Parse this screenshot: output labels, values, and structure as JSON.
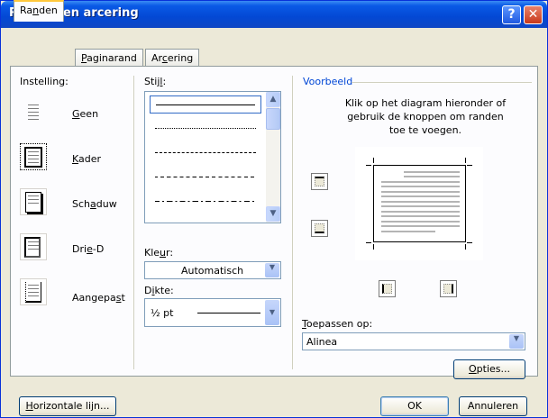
{
  "window": {
    "title": "Randen en arcering",
    "help_label": "?",
    "close_label": "✕"
  },
  "tabs": [
    {
      "label_pre": "Ra",
      "label_key": "n",
      "label_post": "den"
    },
    {
      "label_pre": "",
      "label_key": "P",
      "label_post": "aginarand"
    },
    {
      "label_pre": "Ar",
      "label_key": "c",
      "label_post": "ering"
    }
  ],
  "instelling": {
    "label": "Instelling:",
    "options": [
      {
        "pre": "",
        "key": "G",
        "post": "een"
      },
      {
        "pre": "",
        "key": "K",
        "post": "ader"
      },
      {
        "pre": "Sch",
        "key": "a",
        "post": "duw"
      },
      {
        "pre": "Dri",
        "key": "e",
        "post": "-D"
      },
      {
        "pre": "Aangepa",
        "key": "s",
        "post": "t"
      }
    ]
  },
  "stijl": {
    "label_pre": "Stij",
    "label_key": "l",
    "label_post": ":"
  },
  "kleur": {
    "label_pre": "Kle",
    "label_key": "u",
    "label_post": "r:",
    "value": "Automatisch"
  },
  "dikte": {
    "label_pre": "D",
    "label_key": "i",
    "label_post": "kte:",
    "value": "½ pt"
  },
  "voorbeeld": {
    "label": "Voorbeeld",
    "instruction_1": "Klik op het diagram hieronder of",
    "instruction_2": "gebruik de knoppen om randen",
    "instruction_3": "toe te voegen."
  },
  "toepassen": {
    "label_pre": "",
    "label_key": "T",
    "label_post": "oepassen op:",
    "value": "Alinea"
  },
  "buttons": {
    "opties_pre": "",
    "opties_key": "O",
    "opties_post": "pties...",
    "horizontaal_pre": "",
    "horizontaal_key": "H",
    "horizontaal_post": "orizontale lijn...",
    "ok": "OK",
    "annuleren": "Annuleren"
  },
  "colors": {
    "title_bar": "#0348d4",
    "group_label": "#0046d5",
    "dialog_bg": "#ece9d8"
  },
  "icons": {
    "help": "help-icon",
    "close": "close-icon",
    "scroll_up": "chevron-up-icon",
    "scroll_down": "chevron-down-icon"
  }
}
